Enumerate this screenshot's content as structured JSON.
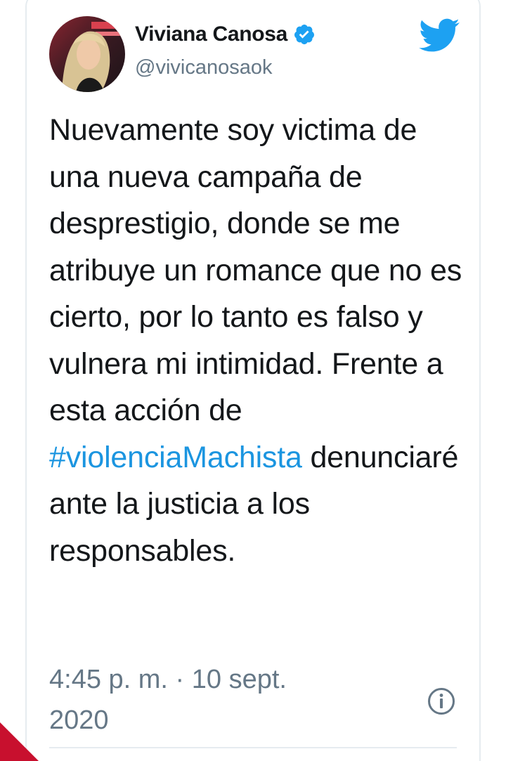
{
  "author": {
    "display_name": "Viviana Canosa",
    "handle": "@vivicanosaok",
    "verified": true
  },
  "tweet": {
    "text_before": "Nuevamente soy victima de una nueva campaña de desprestigio, donde se me atribuye un romance que no es cierto, por lo tanto es falso y vulnera mi intimidad. Frente a esta acción de",
    "hashtag": "#violenciaMachista",
    "text_after": "denunciaré ante la justicia a los responsables."
  },
  "meta": {
    "timestamp": "4:45 p. m. · 10 sept. 2020"
  },
  "icons": {
    "brand": "twitter-bird-icon",
    "verified": "verified-badge-icon",
    "info": "info-icon"
  },
  "colors": {
    "brand": "#1da1f2",
    "hashtag": "#1b95e0",
    "text": "#14171a",
    "muted": "#657786"
  }
}
